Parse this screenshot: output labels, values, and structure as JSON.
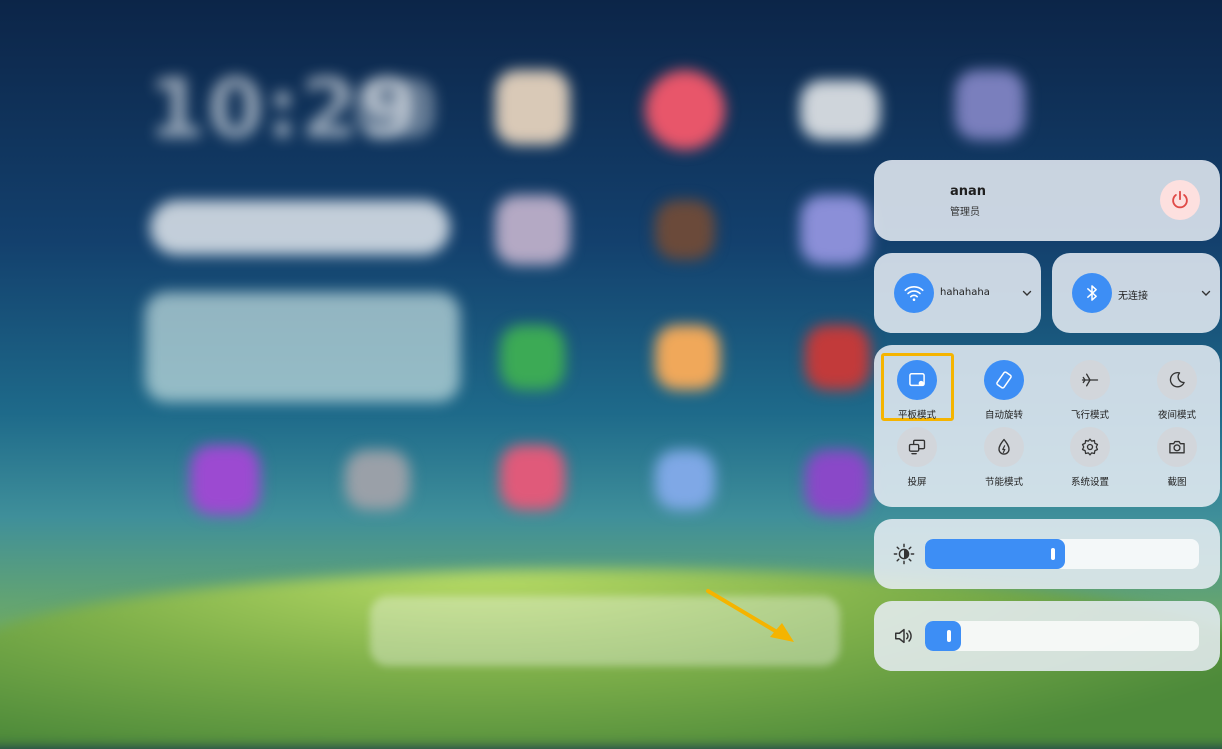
{
  "user": {
    "name": "anan",
    "role": "管理员"
  },
  "wifi": {
    "label": "hahahaha",
    "enabled": true
  },
  "bluetooth": {
    "label": "无连接",
    "enabled": true
  },
  "toggles": [
    {
      "label": "平板模式",
      "icon": "tablet-mode-icon",
      "on": true,
      "highlighted": true
    },
    {
      "label": "自动旋转",
      "icon": "auto-rotate-icon",
      "on": true
    },
    {
      "label": "飞行模式",
      "icon": "airplane-icon",
      "on": false
    },
    {
      "label": "夜间模式",
      "icon": "moon-icon",
      "on": false
    },
    {
      "label": "投屏",
      "icon": "cast-icon",
      "on": false
    },
    {
      "label": "节能模式",
      "icon": "power-save-icon",
      "on": false
    },
    {
      "label": "系统设置",
      "icon": "gear-icon",
      "on": false
    },
    {
      "label": "截图",
      "icon": "camera-icon",
      "on": false
    }
  ],
  "brightness": {
    "level": 0.51
  },
  "volume": {
    "level": 0.13
  },
  "colors": {
    "accent": "#3d8ef5",
    "highlight": "#f5b400",
    "power_bg": "#fde0df",
    "power_icon": "#e04a47"
  }
}
